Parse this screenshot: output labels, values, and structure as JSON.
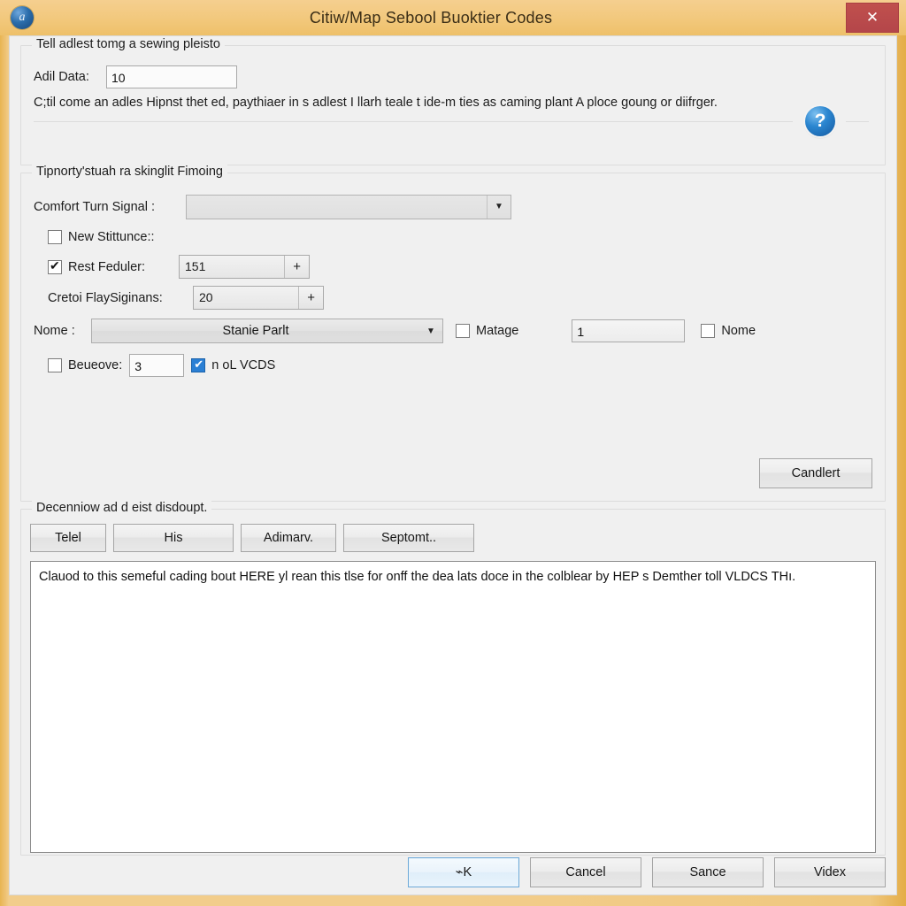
{
  "window": {
    "title": "Citiw/Map Sebool Buoktier Codes",
    "icon": "app-badge-icon",
    "close_label": "✕"
  },
  "top_group": {
    "legend": "Tell adlest tomg a sewing pleisto",
    "field_label": "Adil Data:",
    "field_value": "10",
    "help_icon": "?",
    "note": "C;til come an adles Hipnst thet ed, paythiaer in s adlest I llarh teale t ide-m ties as caming plant A ploce goung or diifrger."
  },
  "mid_group": {
    "legend": "Tipnorty'stuah ra skinglit Fimoing",
    "combo_label": "Comfort Turn Signal :",
    "combo_value": "",
    "checkbox_new": {
      "label": "New Stittunce::",
      "checked": false
    },
    "rest_feduler": {
      "label": "Rest Feduler:",
      "checked": true,
      "value": "151",
      "stepper": "+"
    },
    "cretoi": {
      "label": "Cretoi FlaySiginans:",
      "value": "20",
      "stepper": "+"
    },
    "nome_row": {
      "label": "Nome :",
      "combo_value": "Stanie Parlt",
      "matage_label": "Matage",
      "matage_checked": false,
      "count_value": "1",
      "nome_label": "Nome",
      "nome_checked": false
    },
    "beueove": {
      "label": "Beueove:",
      "checked": false,
      "value": "3",
      "vcds_label": "n oL VCDS",
      "vcds_checked": true
    },
    "action_button": "Candlert"
  },
  "bottom_group": {
    "legend": "Decenniow ad d eist disdoupt.",
    "tabs": [
      {
        "label": "Telel"
      },
      {
        "label": "His"
      },
      {
        "label": "Adimarv."
      },
      {
        "label": "Septomt.."
      }
    ],
    "log_text": "Clauod to this semeful cading bout HERE yl rean this tlse for onff the dea lats doce in the colblear by HEP s Demther toll VLDCS THı."
  },
  "footer": {
    "buttons": [
      {
        "label": "⌁K",
        "name": "ok-button",
        "default": true
      },
      {
        "label": "Cancel",
        "name": "cancel-button",
        "default": false
      },
      {
        "label": "Sance",
        "name": "sance-button",
        "default": false
      },
      {
        "label": "Videx",
        "name": "videx-button",
        "default": false
      }
    ]
  }
}
